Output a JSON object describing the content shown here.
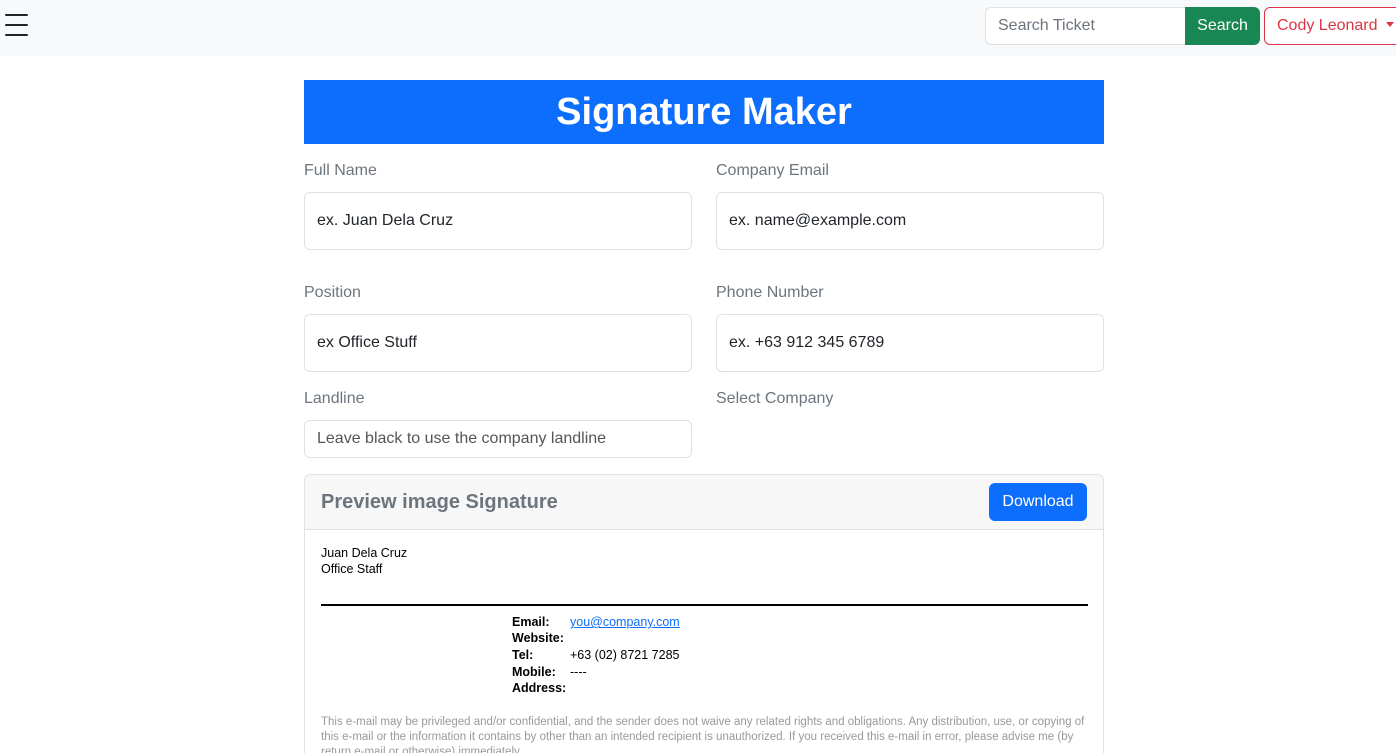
{
  "topbar": {
    "menu_icon": "hamburger-menu-icon",
    "search_placeholder": "Search Ticket",
    "search_label": "Search",
    "user_name": "Cody Leonard"
  },
  "banner": {
    "title": "Signature Maker"
  },
  "form": {
    "full_name": {
      "label": "Full Name",
      "placeholder": "ex. Juan Dela Cruz"
    },
    "company_email": {
      "label": "Company Email",
      "placeholder": "ex. name@example.com"
    },
    "position": {
      "label": "Position",
      "placeholder": "ex Office Stuff"
    },
    "phone": {
      "label": "Phone Number",
      "placeholder": "ex. +63 912 345 6789"
    },
    "landline": {
      "label": "Landline",
      "placeholder": "Leave black to use the company landline"
    },
    "company": {
      "label": "Select Company"
    }
  },
  "preview": {
    "title": "Preview image Signature",
    "download_label": "Download",
    "name": "Juan Dela Cruz",
    "position": "Office Staff",
    "email_label": "Email:",
    "email_value": "you@company.com",
    "website_label": "Website:",
    "website_value": "",
    "tel_label": "Tel:",
    "tel_value": "+63 (02) 8721 7285",
    "mobile_label": "Mobile:",
    "mobile_value": "----",
    "address_label": "Address:",
    "address_value": "",
    "disclaimer": "This e-mail may be privileged and/or confidential, and the sender does not waive any related rights and obligations. Any distribution, use, or copying of this e-mail or the information it contains by other than an intended recipient is unauthorized. If you received this e-mail in error, please advise me (by return e-mail or otherwise) immediately."
  }
}
